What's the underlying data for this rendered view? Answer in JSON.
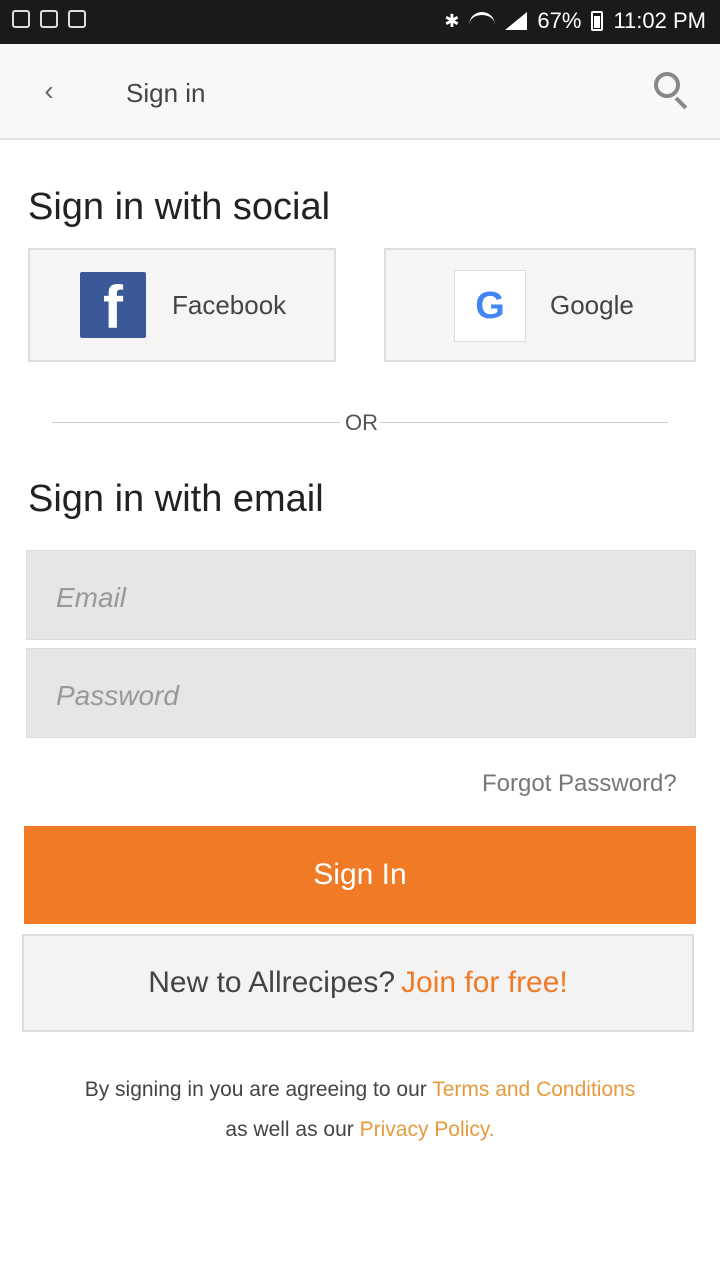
{
  "status_bar": {
    "battery": "67%",
    "time": "11:02 PM"
  },
  "toolbar": {
    "title": "Sign in"
  },
  "social": {
    "heading": "Sign in with social",
    "facebook_label": "Facebook",
    "google_label": "Google"
  },
  "divider": {
    "text": "OR"
  },
  "email_section": {
    "heading": "Sign in with email",
    "email_placeholder": "Email",
    "password_placeholder": "Password",
    "forgot_password": "Forgot Password?",
    "signin_label": "Sign In"
  },
  "join": {
    "prompt": "New to Allrecipes?",
    "link": "Join for free!"
  },
  "terms": {
    "prefix": "By signing in you are agreeing to our ",
    "terms_link": "Terms and Conditions",
    "middle": "as well as our ",
    "privacy_link": "Privacy Policy."
  },
  "colors": {
    "accent": "#f07a26",
    "facebook": "#3b5998"
  }
}
